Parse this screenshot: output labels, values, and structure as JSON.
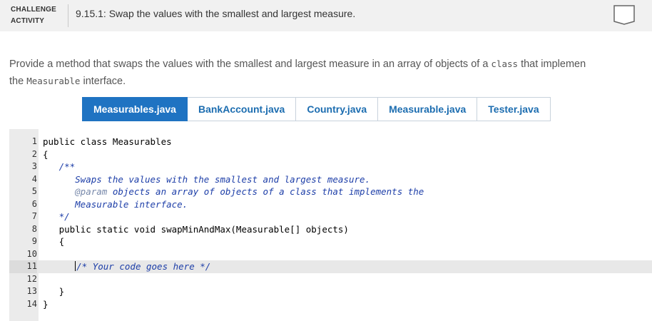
{
  "header": {
    "tag_line1": "CHALLENGE",
    "tag_line2": "ACTIVITY",
    "title": "9.15.1: Swap the values with the smallest and largest measure."
  },
  "prompt": {
    "part1": "Provide a method that swaps the values with the smallest and largest measure in an array of objects of a ",
    "code1": "class",
    "part2": " that implemen",
    "part3": "the ",
    "code2": "Measurable",
    "part4": " interface."
  },
  "tabs": [
    {
      "label": "Measurables.java",
      "active": true
    },
    {
      "label": "BankAccount.java",
      "active": false
    },
    {
      "label": "Country.java",
      "active": false
    },
    {
      "label": "Measurable.java",
      "active": false
    },
    {
      "label": "Tester.java",
      "active": false
    }
  ],
  "editor": {
    "current_line": 11,
    "lines": [
      {
        "n": "1",
        "text": "public class Measurables"
      },
      {
        "n": "2",
        "text": "{"
      },
      {
        "n": "3",
        "text": "   /**"
      },
      {
        "n": "4",
        "text": "      Swaps the values with the smallest and largest measure."
      },
      {
        "n": "5",
        "tag": "@param",
        "text": " objects an array of objects of a class that implements the"
      },
      {
        "n": "6",
        "text": "      Measurable interface."
      },
      {
        "n": "7",
        "text": "   */"
      },
      {
        "n": "8",
        "text": "   public static void swapMinAndMax(Measurable[] objects)"
      },
      {
        "n": "9",
        "text": "   {"
      },
      {
        "n": "10",
        "text": ""
      },
      {
        "n": "11",
        "text": "/* Your code goes here */"
      },
      {
        "n": "12",
        "text": ""
      },
      {
        "n": "13",
        "text": "   }"
      },
      {
        "n": "14",
        "text": "}"
      }
    ]
  },
  "colors": {
    "accent": "#1f73c2",
    "comment": "#1d3ea8",
    "header_bg": "#f1f1f1"
  }
}
